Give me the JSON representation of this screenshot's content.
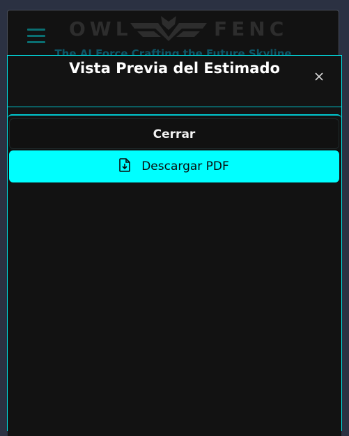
{
  "background_app": {
    "logo_left": "OWL",
    "logo_right": "FENC",
    "tagline": "The AI Force Crafting the Future Skyline"
  },
  "dialog": {
    "title": "Vista Previa del Estimado",
    "close_icon": "close-icon",
    "close_button_label": "Cerrar",
    "download_button_label": "Descargar PDF",
    "download_icon": "file-download-icon"
  },
  "colors": {
    "accent": "#00FFFF",
    "dialog_bg": "#131313",
    "page_bg": "#2B3142"
  }
}
